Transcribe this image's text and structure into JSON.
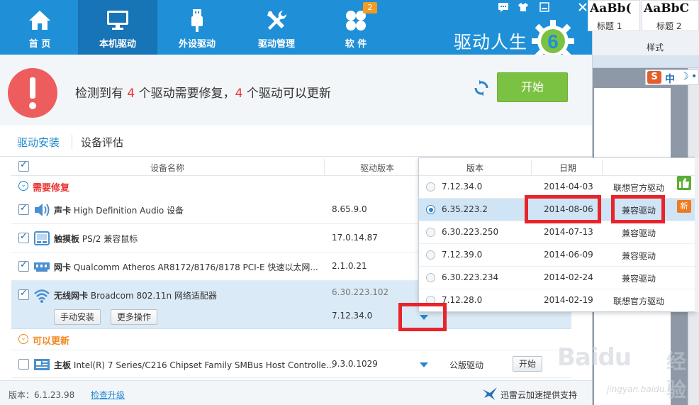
{
  "nav": {
    "tabs": [
      {
        "label": "首 页",
        "icon": "home-icon"
      },
      {
        "label": "本机驱动",
        "icon": "monitor-icon",
        "active": true
      },
      {
        "label": "外设驱动",
        "icon": "usb-icon"
      },
      {
        "label": "驱动管理",
        "icon": "tools-icon"
      },
      {
        "label": "软 件",
        "icon": "apps-icon",
        "badge": "2"
      }
    ],
    "window_icons": [
      "message-icon",
      "skin-icon",
      "minimize-icon",
      "close-icon"
    ]
  },
  "brand": {
    "name": "驱动人生",
    "logo_digit": "6"
  },
  "status": {
    "prefix": "检测到有",
    "repair_count": "4",
    "middle": "个驱动需要修复，",
    "update_count": "4",
    "suffix": "个驱动可以更新",
    "start_label": "开始"
  },
  "subtabs": {
    "driver_install": "驱动安装",
    "device_eval": "设备评估"
  },
  "table": {
    "col_name": "设备名称",
    "col_version": "驱动版本"
  },
  "sections": {
    "repair": "需要修复",
    "update": "可以更新"
  },
  "rows": [
    {
      "category": "声卡",
      "name": "High Definition Audio 设备",
      "version": "8.65.9.0",
      "icon": "speaker-icon"
    },
    {
      "category": "触摸板",
      "name": "PS/2 兼容鼠标",
      "version": "17.0.14.87",
      "icon": "touchpad-icon"
    },
    {
      "category": "网卡",
      "name": "Qualcomm Atheros AR8172/8176/8178 PCI-E 快速以太网...",
      "version": "2.1.0.21",
      "icon": "network-card-icon"
    },
    {
      "category": "无线网卡",
      "name": "Broadcom 802.11n 网络适配器",
      "version": "6.30.223.102",
      "new_version": "7.12.34.0",
      "icon": "wifi-icon"
    },
    {
      "category": "主板",
      "name": "Intel(R) 7 Series/C216 Chipset Family SMBus Host Controlle...",
      "version": "9.3.0.1029",
      "type": "公版驱动",
      "action": "开始",
      "icon": "motherboard-icon"
    }
  ],
  "wifi_actions": {
    "manual_install": "手动安装",
    "more_ops": "更多操作"
  },
  "popup": {
    "col_version": "版本",
    "col_date": "日期",
    "items": [
      {
        "version": "7.12.34.0",
        "date": "2014-04-03",
        "type": "联想官方驱动"
      },
      {
        "version": "6.35.223.2",
        "date": "2014-08-06",
        "type": "兼容驱动",
        "selected": true
      },
      {
        "version": "6.30.223.250",
        "date": "2014-07-13",
        "type": "兼容驱动"
      },
      {
        "version": "7.12.39.0",
        "date": "2014-06-09",
        "type": "兼容驱动"
      },
      {
        "version": "6.30.223.234",
        "date": "2014-02-24",
        "type": "兼容驱动"
      },
      {
        "version": "7.12.28.0",
        "date": "2014-02-19",
        "type": "联想官方驱动"
      }
    ],
    "badge_new": "新"
  },
  "footer": {
    "version": "版本：6.1.23.98",
    "check_upgrade": "检查升级",
    "thunder": "迅雷云加速提供支持"
  },
  "word": {
    "styles": [
      {
        "sample": "AaBb(",
        "name": "标题 1"
      },
      {
        "sample": "AaBbC",
        "name": "标题 2"
      }
    ],
    "ribbon_label": "样式",
    "ime_lang": "中"
  },
  "watermark": {
    "brand": "Baidu",
    "jy": "经验",
    "url": "jingyan.baidu.com"
  },
  "colors": {
    "accent": "#1f90d8",
    "nav_active": "#1774b6",
    "start_green": "#7cc242",
    "alert_red": "#ee5d5d",
    "count_red": "#e33333",
    "highlight": "#e8242b"
  }
}
